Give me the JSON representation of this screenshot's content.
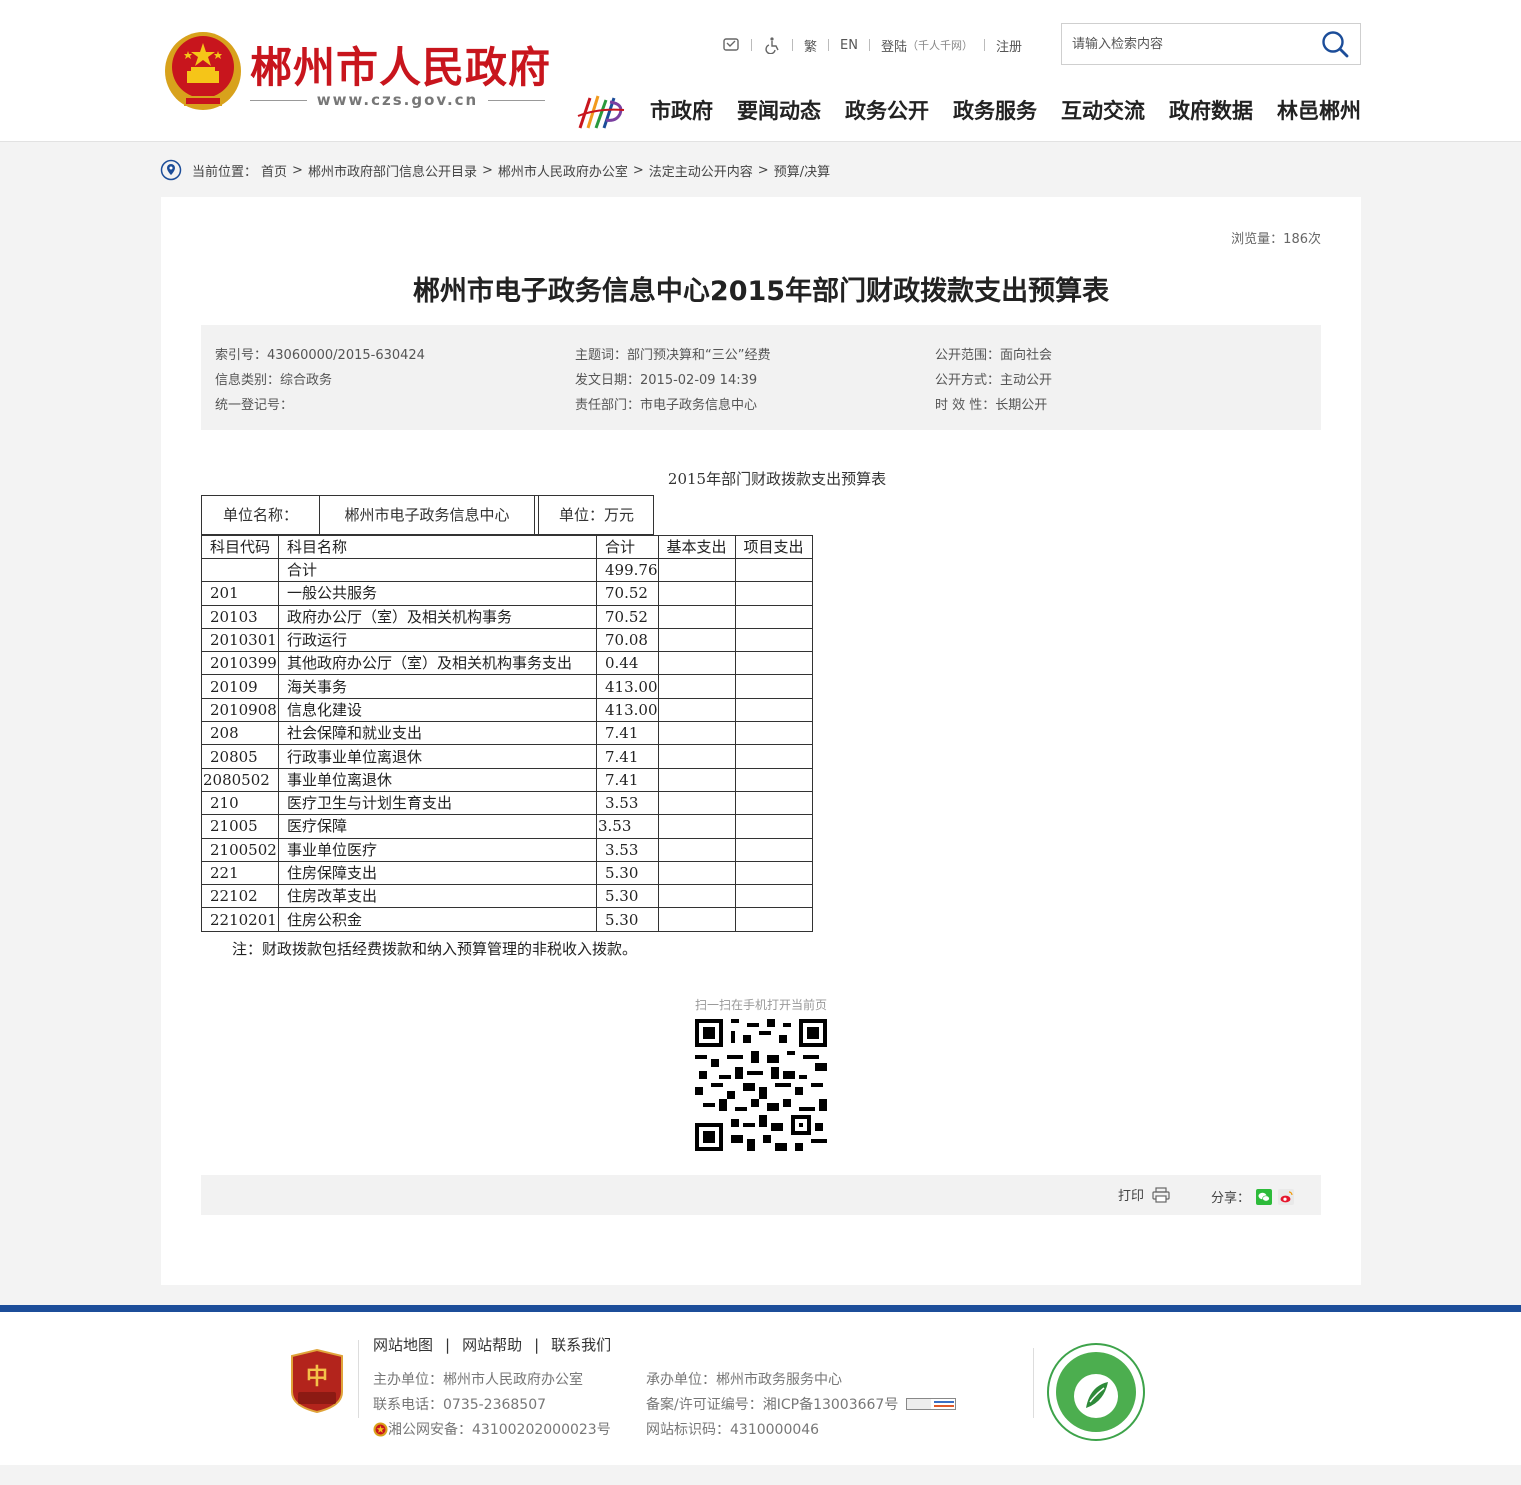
{
  "header": {
    "site_title": "郴州市人民政府",
    "site_url": "www.czs.gov.cn",
    "toplinks": {
      "traditional": "繁",
      "english": "EN",
      "login": "登陆",
      "login_note": "（千人千网）",
      "register": "注册"
    },
    "search": {
      "placeholder": "请输入检索内容"
    },
    "nav": [
      "市政府",
      "要闻动态",
      "政务公开",
      "政务服务",
      "互动交流",
      "政府数据",
      "林邑郴州"
    ]
  },
  "breadcrumb": {
    "label": "当前位置：",
    "items": [
      "首页",
      "郴州市政府部门信息公开目录",
      "郴州市人民政府办公室",
      "法定主动公开内容",
      "预算/决算"
    ]
  },
  "article": {
    "views": "浏览量：186次",
    "title": "郴州市电子政务信息中心2015年部门财政拨款支出预算表",
    "meta": {
      "index_no": "索引号：43060000/2015-630424",
      "category": "信息类别：综合政务",
      "reg_no": "统一登记号：",
      "subject": "主题词：部门预决算和“三公”经费",
      "date": "发文日期：2015-02-09 14:39",
      "dept": "责任部门：市电子政务信息中心",
      "scope": "公开范围：面向社会",
      "mode": "公开方式：主动公开",
      "validity": "时 效 性：长期公开"
    },
    "table_caption": "2015年部门财政拨款支出预算表",
    "unit_row": {
      "unit_label": "单位名称：",
      "unit_value": "郴州市电子政务信息中心",
      "unit_measure": "单位：万元"
    },
    "table_headers": [
      "科目代码",
      "科目名称",
      "合计",
      "基本支出",
      "项目支出"
    ],
    "rows": [
      {
        "code": "",
        "name": "合计",
        "total": "499.76"
      },
      {
        "code": "201",
        "name": "一般公共服务",
        "total": "70.52"
      },
      {
        "code": "20103",
        "name": "政府办公厅（室）及相关机构事务",
        "total": "70.52"
      },
      {
        "code": "2010301",
        "name": "行政运行",
        "total": "70.08"
      },
      {
        "code": "2010399",
        "name": "其他政府办公厅（室）及相关机构事务支出",
        "total": "0.44"
      },
      {
        "code": "20109",
        "name": "海关事务",
        "total": "413.00"
      },
      {
        "code": "2010908",
        "name": "信息化建设",
        "total": "413.00"
      },
      {
        "code": "208",
        "name": "社会保障和就业支出",
        "total": "7.41"
      },
      {
        "code": "20805",
        "name": "行政事业单位离退休",
        "total": "7.41"
      },
      {
        "code": "2080502",
        "name": "事业单位离退休",
        "total": "7.41"
      },
      {
        "code": "210",
        "name": "医疗卫生与计划生育支出",
        "total": "3.53"
      },
      {
        "code": "21005",
        "name": "医疗保障",
        "total": "3.53"
      },
      {
        "code": "2100502",
        "name": "事业单位医疗",
        "total": "3.53"
      },
      {
        "code": "221",
        "name": "住房保障支出",
        "total": "5.30"
      },
      {
        "code": "22102",
        "name": "住房改革支出",
        "total": "5.30"
      },
      {
        "code": "2210201",
        "name": "住房公积金",
        "total": "5.30"
      }
    ],
    "note": "注：财政拨款包括经费拨款和纳入预算管理的非税收入拨款。",
    "qr_label": "扫一扫在手机打开当前页",
    "print": "打印",
    "share": "分享："
  },
  "footer": {
    "links": [
      "网站地图",
      "网站帮助",
      "联系我们"
    ],
    "sponsor": "主办单位：郴州市人民政府办公室",
    "phone": "联系电话：0735-2368507",
    "police": "湘公网安备：43100202000023号",
    "organizer": "承办单位：郴州市政务服务中心",
    "icp": "备案/许可证编号：湘ICP备13003667号",
    "site_code": "网站标识码：4310000046"
  },
  "colors": {
    "brand_red": "#c8151d",
    "footer_blue": "#1c4d99"
  }
}
